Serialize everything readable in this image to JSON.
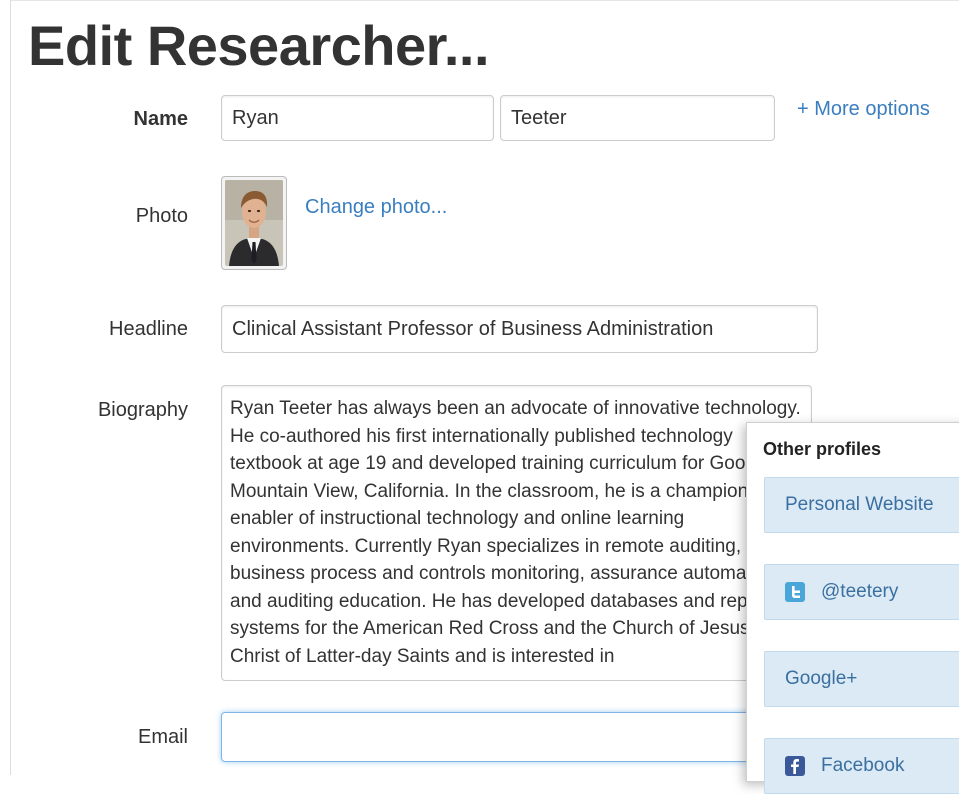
{
  "page": {
    "title": "Edit Researcher..."
  },
  "name": {
    "label": "Name",
    "first_value": "Ryan",
    "last_value": "Teeter",
    "more_options": "+ More options"
  },
  "photo": {
    "label": "Photo",
    "change_link": "Change photo..."
  },
  "headline": {
    "label": "Headline",
    "value": "Clinical Assistant Professor of Business Administration"
  },
  "biography": {
    "label": "Biography",
    "value": "Ryan Teeter has always been an advocate of innovative technology. He co-authored his first internationally published technology textbook at age 19 and developed training curriculum for Google in Mountain View, California. In the classroom, he is a champion and enabler of instructional technology and online learning environments. Currently Ryan specializes in remote auditing, business process and controls monitoring, assurance automation and auditing education. He has developed databases and reporting systems for the American Red Cross and the Church of Jesus Christ of Latter-day Saints and is interested in"
  },
  "email": {
    "label": "Email",
    "value": ""
  },
  "other_profiles": {
    "title": "Other profiles",
    "items": [
      {
        "label": "Personal Website",
        "icon": ""
      },
      {
        "label": "@teetery",
        "icon": "twitter-icon"
      },
      {
        "label": "Google+",
        "icon": ""
      },
      {
        "label": "Facebook",
        "icon": "facebook-icon"
      }
    ]
  },
  "colors": {
    "link": "#3a7ec0",
    "profile_bg": "#dceaf6",
    "twitter": "#4aa6d9",
    "facebook": "#3b5998",
    "focus_border": "#7fb4e4"
  }
}
